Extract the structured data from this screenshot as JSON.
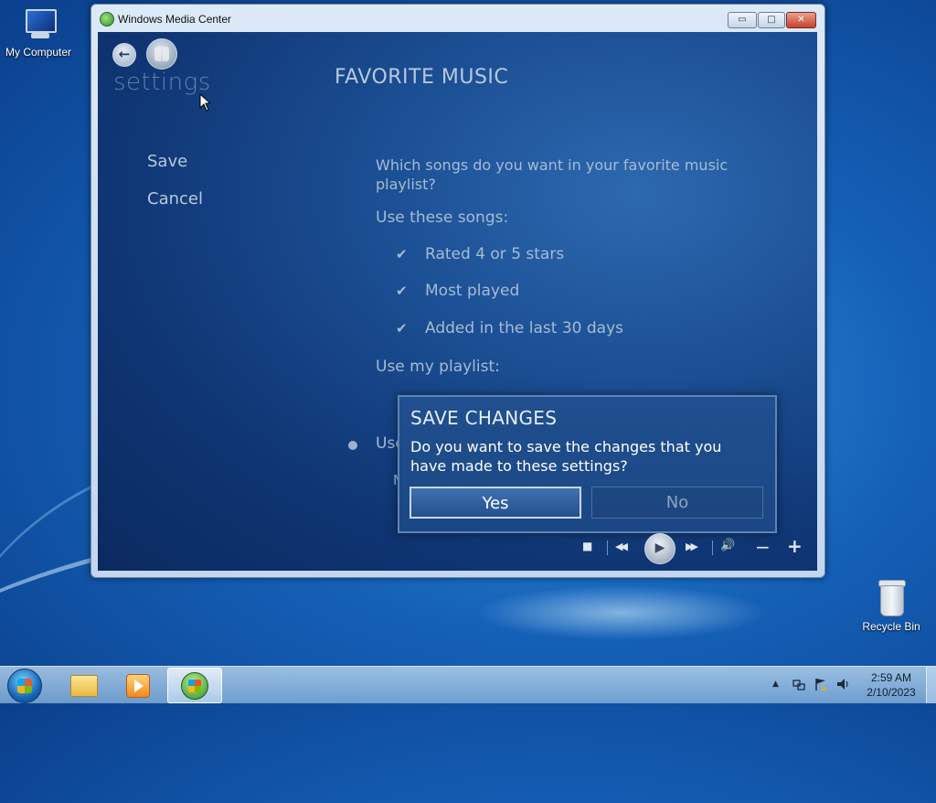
{
  "desktop": {
    "icons": [
      {
        "label": "My Computer",
        "icon": "computer-icon"
      },
      {
        "label": "Recycle Bin",
        "icon": "recycle-bin-icon"
      }
    ]
  },
  "window": {
    "title": "Windows Media Center",
    "controls": {
      "minimize": "▭",
      "maximize": "□",
      "close": "✕"
    }
  },
  "media_center": {
    "section": "settings",
    "page_title": "FAVORITE MUSIC",
    "side_menu": [
      "Save",
      "Cancel"
    ],
    "question": "Which songs do you want in your favorite music playlist?",
    "use_these_songs_label": "Use these songs:",
    "options": [
      {
        "label": "Rated 4 or 5 stars",
        "checked": true
      },
      {
        "label": "Most played",
        "checked": true
      },
      {
        "label": "Added in the last 30 days",
        "checked": true
      }
    ],
    "use_my_playlist_label": "Use my playlist:",
    "partial_radio_text": "Use",
    "partial_sub_text": "M"
  },
  "dialog": {
    "title": "SAVE CHANGES",
    "message": "Do you want to save the changes that you have made to these settings?",
    "yes_label": "Yes",
    "no_label": "No"
  },
  "transport": {
    "stop": "■",
    "rewind": "◀◀",
    "play": "▶",
    "forward": "▶▶",
    "volume": "🔊",
    "vol_down": "−",
    "vol_up": "+"
  },
  "taskbar": {
    "clock_time": "2:59 AM",
    "clock_date": "2/10/2023",
    "tray_arrow": "▲"
  }
}
